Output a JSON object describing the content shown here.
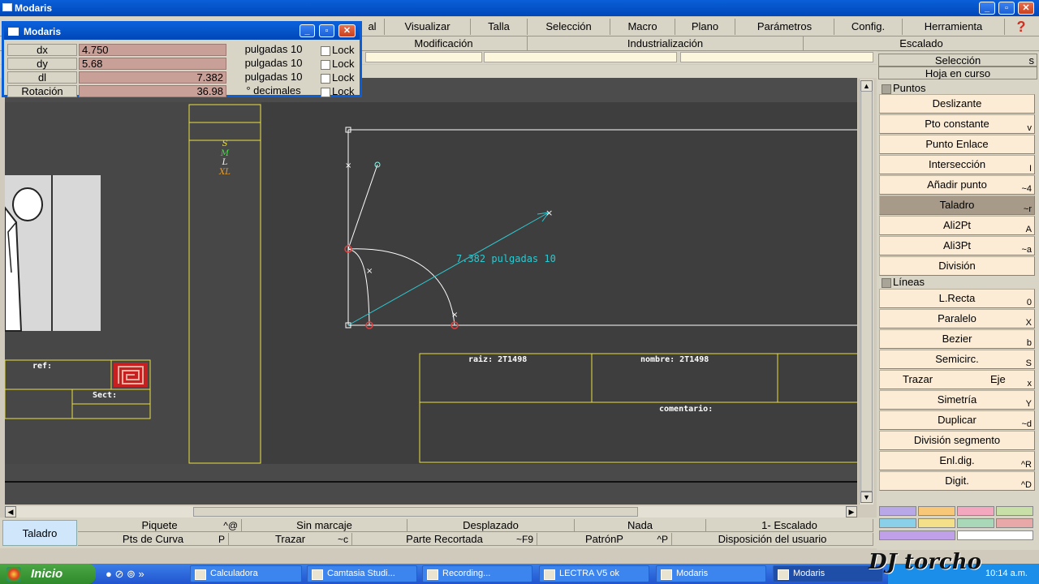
{
  "window": {
    "title": "Modaris"
  },
  "menu": [
    "al",
    "Visualizar",
    "Talla",
    "Selección",
    "Macro",
    "Plano",
    "Parámetros",
    "Config.",
    "Herramienta"
  ],
  "help_icon": "?",
  "submenu": [
    "Modificación",
    "Industrialización",
    "Escalado"
  ],
  "dialog": {
    "title": "Modaris",
    "rows": [
      {
        "label": "dx",
        "value": "4.750",
        "unit": "pulgadas 10",
        "lock": "Lock"
      },
      {
        "label": "dy",
        "value": "5.68",
        "unit": "pulgadas 10",
        "lock": "Lock"
      },
      {
        "label": "dl",
        "value": "7.382",
        "unit": "pulgadas 10",
        "lock": "Lock"
      },
      {
        "label": "Rotación",
        "value": "36.98",
        "unit": "° decimales",
        "lock": "Lock"
      }
    ]
  },
  "right_panel": {
    "header1": "Selección",
    "header1_key": "s",
    "header2": "Hoja en curso",
    "section_points": "Puntos",
    "points": [
      {
        "label": "Deslizante",
        "key": ""
      },
      {
        "label": "Pto constante",
        "key": "v"
      },
      {
        "label": "Punto Enlace",
        "key": ""
      },
      {
        "label": "Intersección",
        "key": "I"
      },
      {
        "label": "Añadir punto",
        "key": "~4"
      },
      {
        "label": "Taladro",
        "key": "~r",
        "selected": true
      },
      {
        "label": "Ali2Pt",
        "key": "A"
      },
      {
        "label": "Ali3Pt",
        "key": "~a"
      },
      {
        "label": "División",
        "key": ""
      }
    ],
    "section_lines": "Líneas",
    "lines": [
      {
        "label": "L.Recta",
        "key": "0"
      },
      {
        "label": "Paralelo",
        "key": "X"
      },
      {
        "label": "Bezier",
        "key": "b"
      },
      {
        "label": "Semicirc.",
        "key": "S"
      },
      {
        "label": "Simetría",
        "key": "Y"
      },
      {
        "label": "Duplicar",
        "key": "~d"
      },
      {
        "label": "División segmento",
        "key": ""
      },
      {
        "label": "Enl.dig.",
        "key": "^R"
      },
      {
        "label": "Digit.",
        "key": "^D"
      }
    ],
    "trazar": "Trazar",
    "eje": "Eje",
    "trazar_key": "x",
    "swatches": [
      [
        "#b8a8e8",
        "#f8c878",
        "#f4a8c0",
        "#c8e0a8"
      ],
      [
        "#8ad0e8",
        "#f4e088",
        "#a8d8b8",
        "#e8a8a8"
      ],
      [
        "#c0a0e8",
        "#ffffff"
      ]
    ]
  },
  "canvas": {
    "measure_label": "7.382 pulgadas 10",
    "sizes": [
      {
        "label": "S",
        "color": "#e8e040"
      },
      {
        "label": "M",
        "color": "#40e040"
      },
      {
        "label": "L",
        "color": "#ffffff"
      },
      {
        "label": "XL",
        "color": "#e8a030"
      }
    ],
    "ref_label": "ref:",
    "sect_label": "Sect:",
    "raiz_label": "raiz: 2T1498",
    "nombre_label": "nombre: 2T1498",
    "comentario_label": "comentario:"
  },
  "status": {
    "mode": "Taladro",
    "row1": [
      {
        "label": "Piquete",
        "key": "^@"
      },
      {
        "label": "Sin marcaje",
        "key": ""
      },
      {
        "label": "Desplazado",
        "key": ""
      },
      {
        "label": "Nada",
        "key": ""
      },
      {
        "label": "1- Escalado",
        "key": ""
      }
    ],
    "row2": [
      {
        "label": "Pts de Curva",
        "key": "P"
      },
      {
        "label": "Trazar",
        "key": "~c"
      },
      {
        "label": "Parte Recortada",
        "key": "~F9"
      },
      {
        "label": "PatrónP",
        "key": "^P"
      },
      {
        "label": "Disposición del usuario",
        "key": ""
      }
    ]
  },
  "taskbar": {
    "start": "Inicio",
    "tasks": [
      "Calculadora",
      "Camtasia Studi...",
      "Recording...",
      "LECTRA V5 ok",
      "Modaris",
      "Modaris"
    ],
    "clock": "10:14 a.m.",
    "watermark": "DJ torcho"
  }
}
